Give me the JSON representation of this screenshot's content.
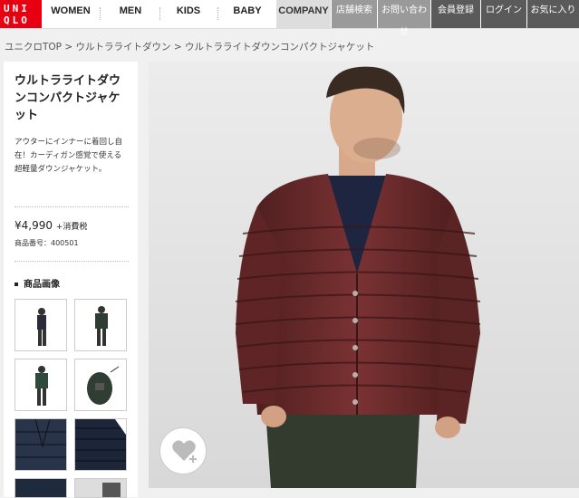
{
  "logo": {
    "line1": "UNI",
    "line2": "QLO"
  },
  "nav": [
    "WOMEN",
    "MEN",
    "KIDS",
    "BABY",
    "COMPANY"
  ],
  "util_nav": [
    "店舗検索",
    "お問い合わせ",
    "会員登録",
    "ログイン",
    "お気に入り"
  ],
  "breadcrumb": "ユニクロTOP > ウルトラライトダウン > ウルトラライトダウンコンパクトジャケット",
  "product": {
    "title": "ウルトラライトダウンコンパクトジャケット",
    "description": "アウターにインナーに着回し自在！カーディガン感覚で使える超軽量ダウンジャケット。",
    "price": "¥4,990",
    "tax": "+消費税",
    "number": "商品番号：400501",
    "images_heading": "商品画像"
  },
  "colors": {
    "brand": "#e60012",
    "jacket": "#6b2a2a"
  },
  "icons": {
    "favorite": "heart-plus-icon"
  }
}
